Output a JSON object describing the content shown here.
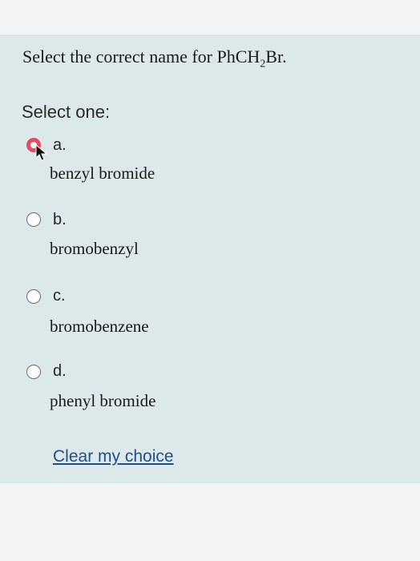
{
  "question": {
    "prefix": "Select the correct name for PhCH",
    "subscript": "2",
    "suffix": "Br."
  },
  "prompt": "Select one:",
  "options": [
    {
      "letter": "a.",
      "answer": "benzyl bromide",
      "selected": true
    },
    {
      "letter": "b.",
      "answer": "bromobenzyl",
      "selected": false
    },
    {
      "letter": "c.",
      "answer": "bromobenzene",
      "selected": false
    },
    {
      "letter": "d.",
      "answer": "phenyl bromide",
      "selected": false
    }
  ],
  "clear_link": "Clear my choice",
  "colors": {
    "panel": "#dde8ea",
    "selected_radio": "#e74b61",
    "link": "#1f4f86"
  }
}
